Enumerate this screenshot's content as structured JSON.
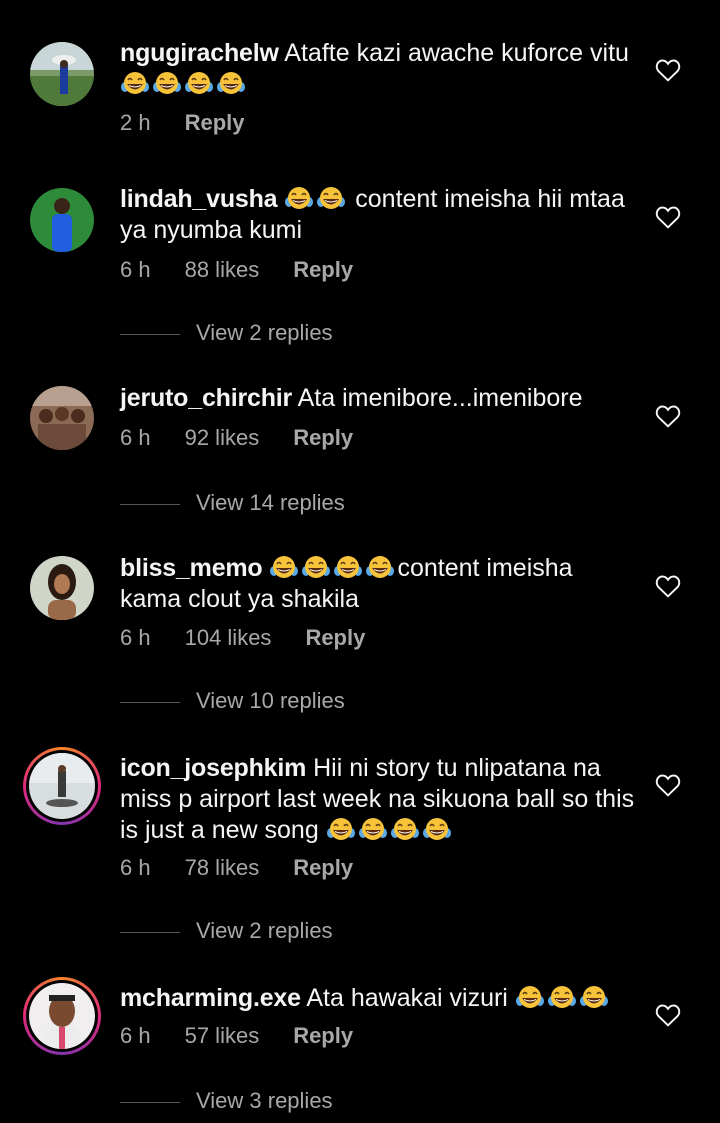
{
  "comments": [
    {
      "username": "ngugirachelw",
      "text_before": " Atafte kazi awache kuforce vitu ",
      "text_after": "",
      "emoji_count": 4,
      "time": "2 h",
      "likes": "",
      "reply_label": "Reply",
      "view_replies": ""
    },
    {
      "username": "lindah_vusha",
      "text_before": " ",
      "text_after": " content imeisha hii mtaa ya nyumba kumi",
      "emoji_count": 2,
      "time": "6 h",
      "likes": "88 likes",
      "reply_label": "Reply",
      "view_replies": "View 2 replies"
    },
    {
      "username": "jeruto_chirchir",
      "text_before": " Ata imenibore...imenibore",
      "text_after": "",
      "emoji_count": 0,
      "time": "6 h",
      "likes": "92 likes",
      "reply_label": "Reply",
      "view_replies": "View 14 replies"
    },
    {
      "username": "bliss_memo",
      "text_before": " ",
      "text_after": "content imeisha kama clout ya shakila",
      "emoji_count": 4,
      "time": "6 h",
      "likes": "104 likes",
      "reply_label": "Reply",
      "view_replies": "View 10 replies"
    },
    {
      "username": "icon_josephkim",
      "text_before": " Hii ni story tu nlipatana na miss p airport last week na sikuona ball so this is just a new song ",
      "text_after": "",
      "emoji_count": 4,
      "time": "6 h",
      "likes": "78 likes",
      "reply_label": "Reply",
      "view_replies": "View 2 replies"
    },
    {
      "username": "mcharming.exe",
      "text_before": " Ata hawakai vizuri ",
      "text_after": "",
      "emoji_count": 3,
      "time": "6 h",
      "likes": "57 likes",
      "reply_label": "Reply",
      "view_replies": "View 3 replies"
    }
  ],
  "icons": {
    "like": "heart-outline-icon",
    "emoji": "tears-of-joy-emoji"
  },
  "colors": {
    "background": "#000000",
    "primary_text": "#f5f5f5",
    "secondary_text": "#a8a8a8",
    "story_ring_start": "#f58529",
    "story_ring_end": "#dd2a7b"
  }
}
